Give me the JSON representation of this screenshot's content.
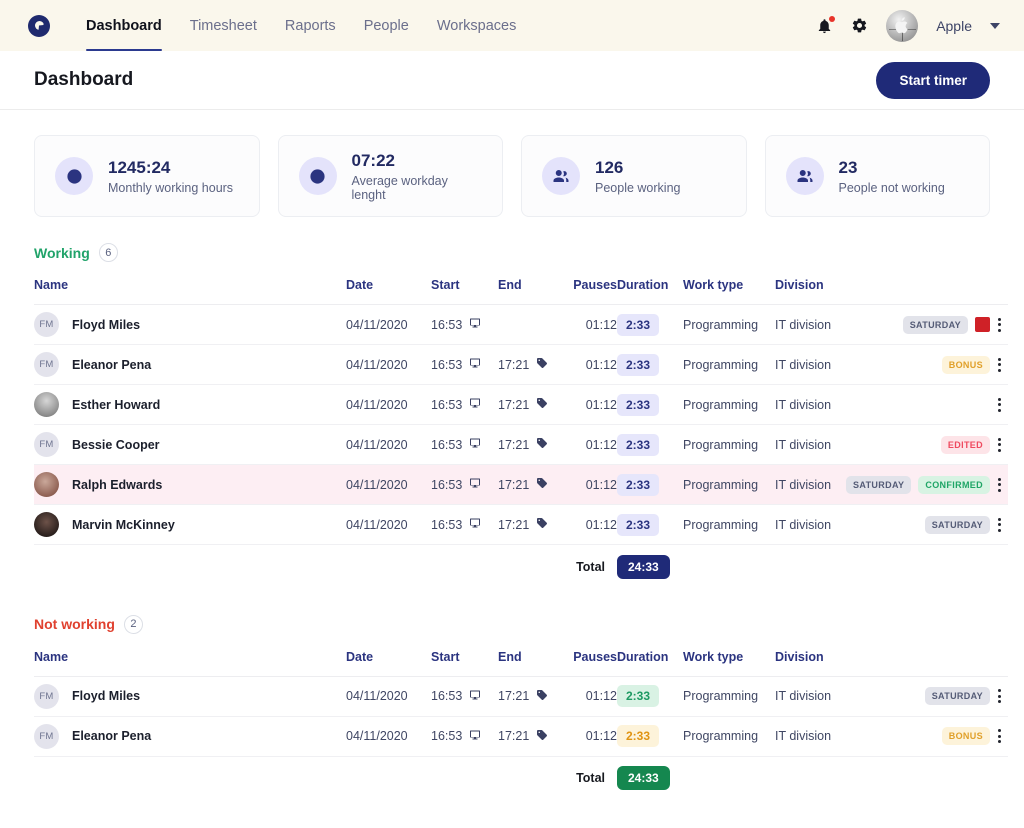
{
  "nav": {
    "logo_icon": "clock-logo-icon",
    "links": [
      {
        "label": "Dashboard",
        "active": true
      },
      {
        "label": "Timesheet",
        "active": false
      },
      {
        "label": "Raports",
        "active": false
      },
      {
        "label": "People",
        "active": false
      },
      {
        "label": "Workspaces",
        "active": false
      }
    ],
    "bell_icon": "notification-bell-icon",
    "gear_icon": "settings-gear-icon",
    "avatar_icon": "apple-avatar-icon",
    "user_name": "Apple",
    "caret_icon": "chevron-down-icon"
  },
  "header": {
    "title": "Dashboard",
    "start_timer_label": "Start timer"
  },
  "cards": [
    {
      "icon": "clock-icon",
      "value": "1245:24",
      "label": "Monthly working hours"
    },
    {
      "icon": "clock-icon",
      "value": "07:22",
      "label": "Average workday lenght"
    },
    {
      "icon": "people-icon",
      "value": "126",
      "label": "People  working"
    },
    {
      "icon": "people-icon",
      "value": "23",
      "label": "People not working"
    }
  ],
  "columns": [
    "Name",
    "Date",
    "Start",
    "End",
    "Pauses",
    "Duration",
    "Work type",
    "Division"
  ],
  "sections": [
    {
      "title": "Working",
      "count": "6",
      "color": "#21a36a",
      "total_label": "Total",
      "total_value": "24:33",
      "total_style": "navy",
      "rows": [
        {
          "avatar": "initials",
          "initials": "FM",
          "name": "Floyd Miles",
          "date": "04/11/2020",
          "start": "16:53",
          "end": "",
          "pauses": "01:12",
          "duration": "2:33",
          "duration_style": "indigo",
          "work_type": "Programming",
          "division": "IT division",
          "tags": [
            "SATURDAY"
          ],
          "red_square": true,
          "highlight": false
        },
        {
          "avatar": "initials",
          "initials": "FM",
          "name": "Eleanor Pena",
          "date": "04/11/2020",
          "start": "16:53",
          "end": "17:21",
          "pauses": "01:12",
          "duration": "2:33",
          "duration_style": "indigo",
          "work_type": "Programming",
          "division": "IT division",
          "tags": [
            "BONUS"
          ],
          "red_square": false,
          "highlight": false
        },
        {
          "avatar": "photo1",
          "initials": "",
          "name": "Esther Howard",
          "date": "04/11/2020",
          "start": "16:53",
          "end": "17:21",
          "pauses": "01:12",
          "duration": "2:33",
          "duration_style": "indigo",
          "work_type": "Programming",
          "division": "IT division",
          "tags": [],
          "red_square": false,
          "highlight": false
        },
        {
          "avatar": "initials",
          "initials": "FM",
          "name": "Bessie Cooper",
          "date": "04/11/2020",
          "start": "16:53",
          "end": "17:21",
          "pauses": "01:12",
          "duration": "2:33",
          "duration_style": "indigo",
          "work_type": "Programming",
          "division": "IT division",
          "tags": [
            "EDITED"
          ],
          "red_square": false,
          "highlight": false
        },
        {
          "avatar": "photo2",
          "initials": "",
          "name": "Ralph Edwards",
          "date": "04/11/2020",
          "start": "16:53",
          "end": "17:21",
          "pauses": "01:12",
          "duration": "2:33",
          "duration_style": "indigo",
          "work_type": "Programming",
          "division": "IT division",
          "tags": [
            "SATURDAY",
            "CONFIRMED"
          ],
          "red_square": false,
          "highlight": true
        },
        {
          "avatar": "photo3",
          "initials": "",
          "name": "Marvin McKinney",
          "date": "04/11/2020",
          "start": "16:53",
          "end": "17:21",
          "pauses": "01:12",
          "duration": "2:33",
          "duration_style": "indigo",
          "work_type": "Programming",
          "division": "IT division",
          "tags": [
            "SATURDAY"
          ],
          "red_square": false,
          "highlight": false
        }
      ]
    },
    {
      "title": "Not working",
      "count": "2",
      "color": "#e0412f",
      "total_label": "Total",
      "total_value": "24:33",
      "total_style": "green",
      "rows": [
        {
          "avatar": "initials",
          "initials": "FM",
          "name": "Floyd Miles",
          "date": "04/11/2020",
          "start": "16:53",
          "end": "17:21",
          "pauses": "01:12",
          "duration": "2:33",
          "duration_style": "green",
          "work_type": "Programming",
          "division": "IT division",
          "tags": [
            "SATURDAY"
          ],
          "red_square": false,
          "highlight": false
        },
        {
          "avatar": "initials",
          "initials": "FM",
          "name": "Eleanor Pena",
          "date": "04/11/2020",
          "start": "16:53",
          "end": "17:21",
          "pauses": "01:12",
          "duration": "2:33",
          "duration_style": "amber",
          "work_type": "Programming",
          "division": "IT division",
          "tags": [
            "BONUS"
          ],
          "red_square": false,
          "highlight": false
        }
      ]
    }
  ],
  "icons": {
    "monitor": "monitor-icon",
    "tag": "tag-icon",
    "kebab": "more-options-icon"
  }
}
